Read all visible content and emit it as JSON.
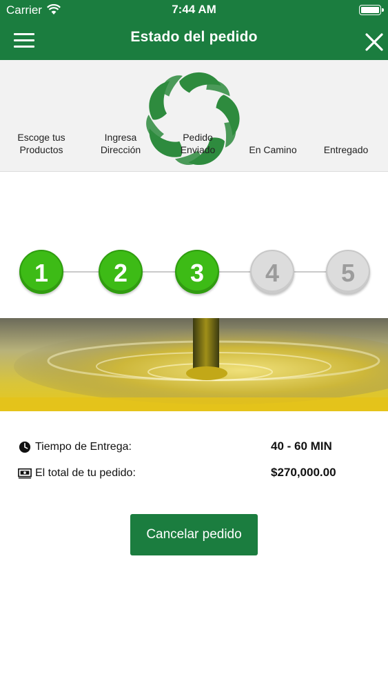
{
  "status_bar": {
    "carrier": "Carrier",
    "time": "7:44 AM"
  },
  "header": {
    "title": "Estado del pedido",
    "menu_icon": "hamburger-icon",
    "close_icon": "close-icon",
    "background": "#1b7d3f"
  },
  "logo": {
    "icon": "leaf-circle-logo",
    "color": "#2e8b3e"
  },
  "steps": [
    {
      "number": "1",
      "label": "Escoge tus\nProductos",
      "state": "done"
    },
    {
      "number": "2",
      "label": "Ingresa\nDirección",
      "state": "done"
    },
    {
      "number": "3",
      "label": "Pedido\nEnviado",
      "state": "done"
    },
    {
      "number": "4",
      "label": "En Camino",
      "state": "pending"
    },
    {
      "number": "5",
      "label": "Entregado",
      "state": "pending"
    }
  ],
  "step_colors": {
    "done": "#3dbb16",
    "pending": "#dcdcdc"
  },
  "banner": {
    "image": "olive-oil-pour-image"
  },
  "delivery": {
    "time_icon": "clock-icon",
    "time_label": "Tiempo de Entrega:",
    "time_value": "40 - 60 MIN",
    "total_icon": "money-icon",
    "total_label": "El total de tu pedido:",
    "total_value": "$270,000.00"
  },
  "actions": {
    "cancel_label": "Cancelar pedido"
  }
}
